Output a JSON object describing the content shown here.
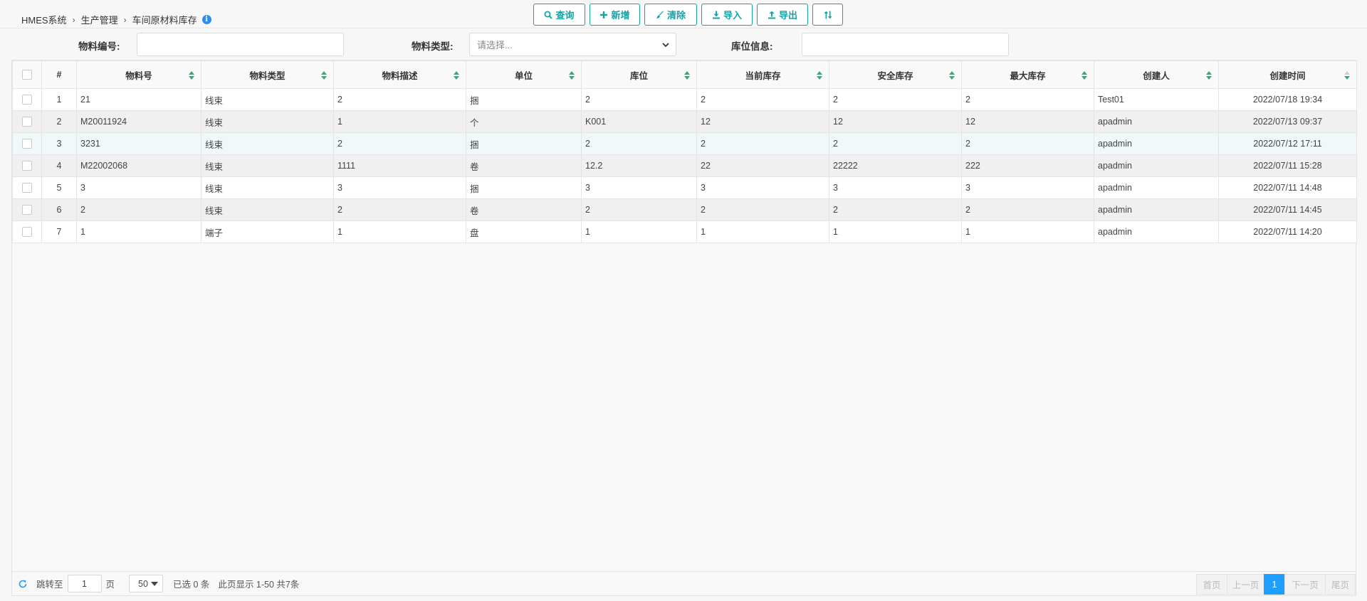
{
  "breadcrumb": {
    "root": "HMES系统",
    "section": "生产管理",
    "current": "车间原材料库存"
  },
  "toolbar": {
    "query": "查询",
    "add": "新增",
    "clear": "清除",
    "import": "导入",
    "export": "导出"
  },
  "filters": {
    "material_no_label": "物料编号:",
    "material_type_label": "物料类型:",
    "material_type_placeholder": "请选择...",
    "location_label": "库位信息:"
  },
  "table": {
    "headers": [
      "#",
      "物料号",
      "物料类型",
      "物料描述",
      "单位",
      "库位",
      "当前库存",
      "安全库存",
      "最大库存",
      "创建人",
      "创建时间"
    ],
    "rows": [
      [
        "1",
        "21",
        "线束",
        "2",
        "捆",
        "2",
        "2",
        "2",
        "2",
        "Test01",
        "2022/07/18 19:34"
      ],
      [
        "2",
        "M20011924",
        "线束",
        "1",
        "个",
        "K001",
        "12",
        "12",
        "12",
        "apadmin",
        "2022/07/13 09:37"
      ],
      [
        "3",
        "3231",
        "线束",
        "2",
        "捆",
        "2",
        "2",
        "2",
        "2",
        "apadmin",
        "2022/07/12 17:11"
      ],
      [
        "4",
        "M22002068",
        "线束",
        "1111",
        "卷",
        "12.2",
        "22",
        "22222",
        "222",
        "apadmin",
        "2022/07/11 15:28"
      ],
      [
        "5",
        "3",
        "线束",
        "3",
        "捆",
        "3",
        "3",
        "3",
        "3",
        "apadmin",
        "2022/07/11 14:48"
      ],
      [
        "6",
        "2",
        "线束",
        "2",
        "卷",
        "2",
        "2",
        "2",
        "2",
        "apadmin",
        "2022/07/11 14:45"
      ],
      [
        "7",
        "1",
        "端子",
        "1",
        "盘",
        "1",
        "1",
        "1",
        "1",
        "apadmin",
        "2022/07/11 14:20"
      ]
    ]
  },
  "footer": {
    "goto_label": "跳转至",
    "page_value": "1",
    "page_unit": "页",
    "page_size": "50",
    "selected": "已选 0 条",
    "summary": "此页显示 1-50 共7条",
    "first": "首页",
    "prev": "上一页",
    "current": "1",
    "next": "下一页",
    "last": "尾页"
  },
  "colors": {
    "accent": "#17a2a4",
    "sort_icon": "#3aa776",
    "active_page": "#1e9fff"
  }
}
